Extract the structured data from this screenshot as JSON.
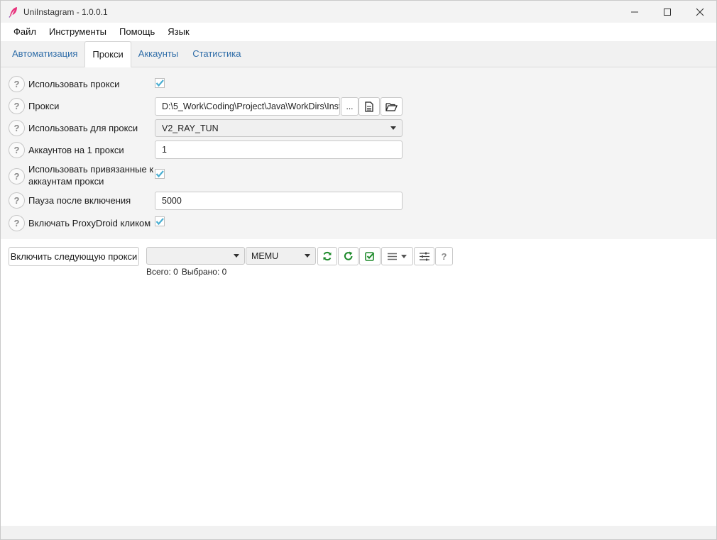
{
  "window": {
    "title": "UniInstagram - 1.0.0.1"
  },
  "menu": [
    "Файл",
    "Инструменты",
    "Помощь",
    "Язык"
  ],
  "tabs": [
    {
      "label": "Автоматизация",
      "active": false
    },
    {
      "label": "Прокси",
      "active": true
    },
    {
      "label": "Аккаунты",
      "active": false
    },
    {
      "label": "Статистика",
      "active": false
    }
  ],
  "settings": {
    "use_proxy": {
      "label": "Использовать прокси",
      "checked": true
    },
    "proxy": {
      "label": "Прокси",
      "value": "D:\\5_Work\\Coding\\Project\\Java\\WorkDirs\\Inst",
      "browse_label": "..."
    },
    "use_for_proxy": {
      "label": "Использовать для прокси",
      "value": "V2_RAY_TUN"
    },
    "accounts_per_proxy": {
      "label": "Аккаунтов на 1 прокси",
      "value": "1"
    },
    "use_bound_proxy": {
      "label_line1": "Использовать привязанные к",
      "label_line2": "аккаунтам прокси",
      "checked": true
    },
    "pause_after": {
      "label": "Пауза после включения",
      "value": "5000"
    },
    "proxydroid_click": {
      "label": "Включать ProxyDroid кликом",
      "checked": true
    }
  },
  "help_label": "?",
  "toolbar": {
    "next_proxy_label": "Включить следующую прокси",
    "select_empty": "",
    "emulator_select": "MEMU",
    "help_label": "?"
  },
  "counts": {
    "total": "Всего: 0",
    "selected": "Выбрано: 0"
  },
  "colors": {
    "accent": "#2f6da8",
    "check": "#4aaed1",
    "green_icon": "#1e8a2b",
    "app_icon": "#e8327c"
  }
}
